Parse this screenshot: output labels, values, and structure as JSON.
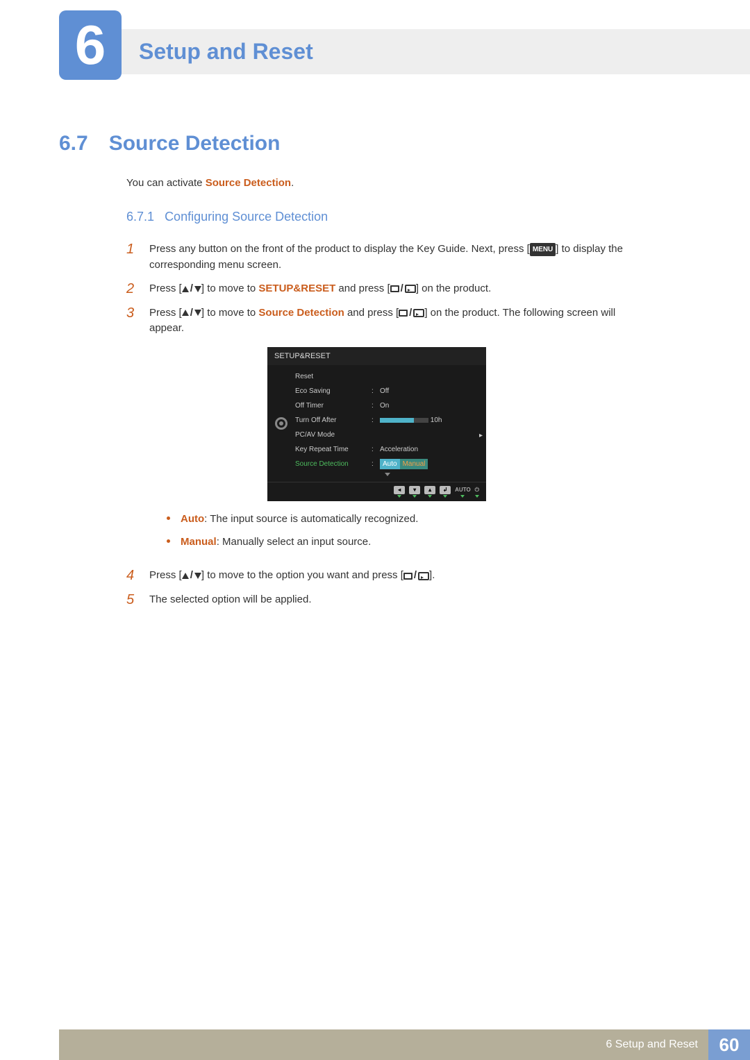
{
  "chapter": {
    "number": "6",
    "title": "Setup and Reset"
  },
  "section": {
    "number": "6.7",
    "title": "Source Detection"
  },
  "intro": {
    "pre": "You can activate ",
    "term": "Source Detection",
    "post": "."
  },
  "subsection": {
    "number": "6.7.1",
    "title": "Configuring Source Detection"
  },
  "steps": {
    "s1": {
      "num": "1",
      "a": "Press any button on the front of the product to display the Key Guide. Next, press [",
      "menu": "MENU",
      "b": "] to display the corresponding menu screen."
    },
    "s2": {
      "num": "2",
      "a": "Press [",
      "b": "] to move to ",
      "term": "SETUP&RESET",
      "c": " and press [",
      "d": "] on the product."
    },
    "s3": {
      "num": "3",
      "a": "Press [",
      "b": "] to move to ",
      "term": "Source Detection",
      "c": " and press [",
      "d": "] on the product. The following screen will appear."
    },
    "s4": {
      "num": "4",
      "a": "Press [",
      "b": "] to move to the option you want and press [",
      "c": "]."
    },
    "s5": {
      "num": "5",
      "text": "The selected option will be applied."
    }
  },
  "osd": {
    "title": "SETUP&RESET",
    "items": {
      "reset": "Reset",
      "eco": "Eco Saving",
      "eco_val": "Off",
      "offtimer": "Off Timer",
      "offtimer_val": "On",
      "turnoff": "Turn Off After",
      "turnoff_val": "10h",
      "pcav": "PC/AV Mode",
      "keyrepeat": "Key Repeat Time",
      "keyrepeat_val": "Acceleration",
      "srcdet": "Source Detection",
      "srcdet_v1": "Auto",
      "srcdet_v2": "Manual"
    },
    "nav_auto": "AUTO"
  },
  "bullets": {
    "auto_t": "Auto",
    "auto_d": ": The input source is automatically recognized.",
    "manual_t": "Manual",
    "manual_d": ": Manually select an input source."
  },
  "footer": {
    "text": "6 Setup and Reset",
    "page": "60"
  }
}
